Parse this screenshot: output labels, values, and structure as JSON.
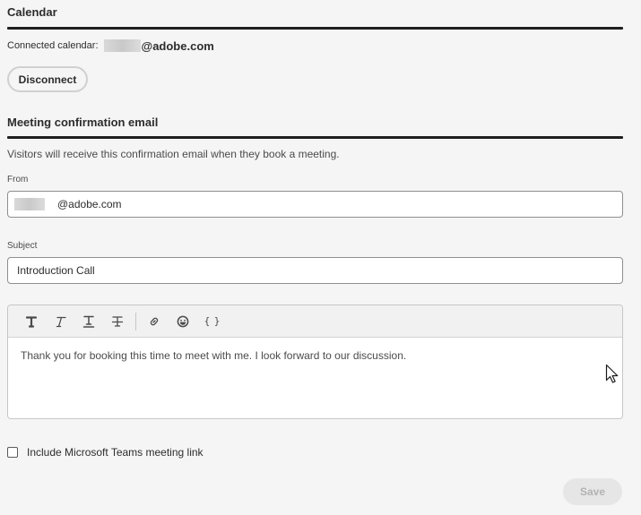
{
  "calendar": {
    "title": "Calendar",
    "connected_label": "Connected calendar:",
    "connected_domain": "@adobe.com",
    "disconnect_label": "Disconnect"
  },
  "confirmation": {
    "title": "Meeting confirmation email",
    "description": "Visitors will receive this confirmation email when they book a meeting.",
    "from_label": "From",
    "from_domain": "@adobe.com",
    "subject_label": "Subject",
    "subject_value": "Introduction Call",
    "toolbar": {
      "icons": [
        "bold-icon",
        "italic-icon",
        "underline-icon",
        "strikethrough-icon",
        "link-icon",
        "emoji-icon",
        "variable-braces-icon"
      ],
      "braces_glyph": "{ }"
    },
    "body_text": "Thank you for booking this time to meet with me. I look forward to our discussion.",
    "teams_checkbox_label": "Include Microsoft Teams meeting link",
    "teams_checked": false,
    "save_label": "Save",
    "save_disabled": true
  }
}
